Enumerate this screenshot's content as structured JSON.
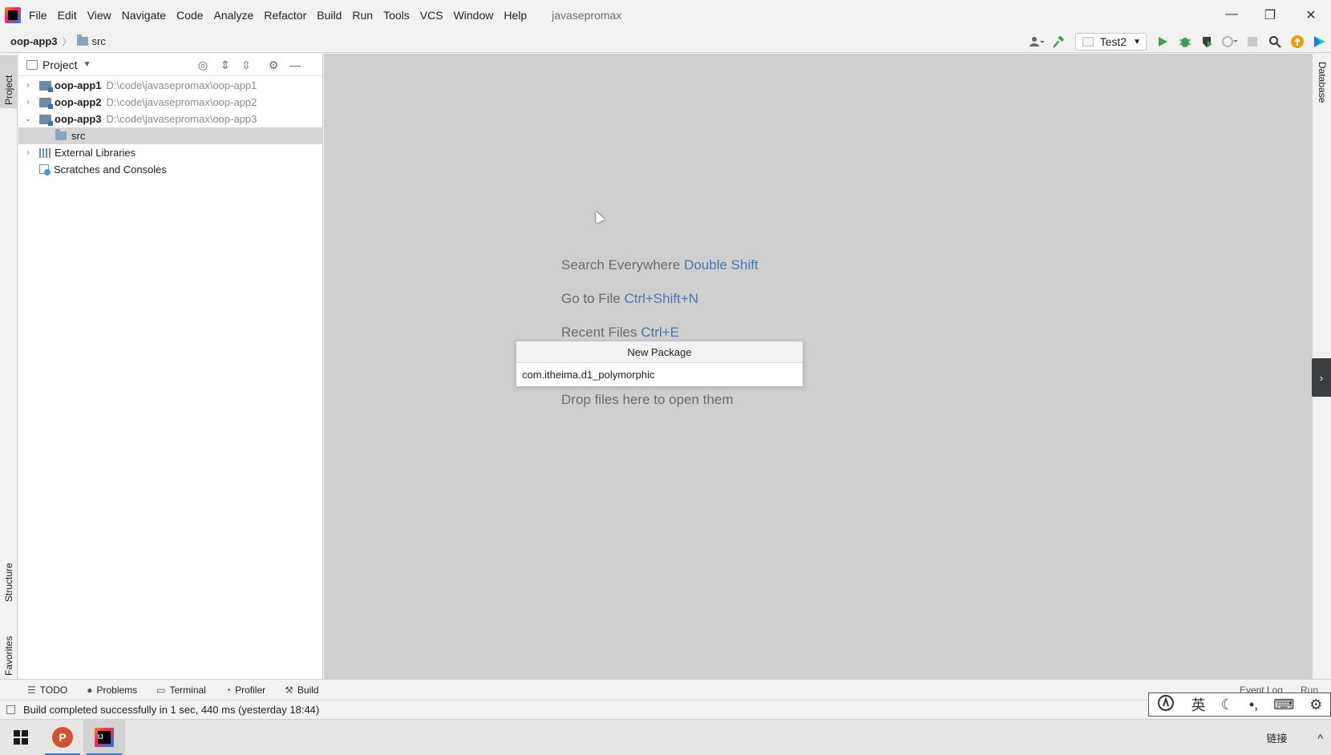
{
  "titlebar": {
    "menu": [
      "File",
      "Edit",
      "View",
      "Navigate",
      "Code",
      "Analyze",
      "Refactor",
      "Build",
      "Run",
      "Tools",
      "VCS",
      "Window",
      "Help"
    ],
    "project_name": "javasepromax",
    "minimize": "—",
    "restore": "❐",
    "close": "✕"
  },
  "navbar": {
    "root": "oop-app3",
    "separator": "〉",
    "folder": "src",
    "run_config": "Test2"
  },
  "left_strip": {
    "project": "Project",
    "structure": "Structure",
    "favorites": "Favorites"
  },
  "project_panel": {
    "title": "Project",
    "tree": [
      {
        "arrow": "›",
        "name": "oop-app1",
        "path": "D:\\code\\javasepromax\\oop-app1"
      },
      {
        "arrow": "›",
        "name": "oop-app2",
        "path": "D:\\code\\javasepromax\\oop-app2"
      },
      {
        "arrow": "⌄",
        "name": "oop-app3",
        "path": "D:\\code\\javasepromax\\oop-app3"
      },
      {
        "name": "src"
      },
      {
        "arrow": "›",
        "name": "External Libraries"
      },
      {
        "name": "Scratches and Consoles"
      }
    ]
  },
  "editor": {
    "hints": [
      {
        "label": "Search Everywhere",
        "key": "Double Shift"
      },
      {
        "label": "Go to File",
        "key": "Ctrl+Shift+N"
      },
      {
        "label": "Recent Files",
        "key": "Ctrl+E"
      },
      {
        "label": "Drop files here to open them",
        "key": ""
      }
    ]
  },
  "new_package": {
    "title": "New Package",
    "value": "com.itheima.d1_polymorphic"
  },
  "right_strip": {
    "database": "Database",
    "collapse": "›"
  },
  "bottom_tabs": [
    {
      "icon": "☰",
      "label": "TODO"
    },
    {
      "icon": "●",
      "label": "Problems"
    },
    {
      "icon": "▭",
      "label": "Terminal"
    },
    {
      "icon": "◔",
      "label": "Profiler"
    },
    {
      "icon": "⚒",
      "label": "Build"
    }
  ],
  "bottom_right_tabs": [
    "Event Log",
    "Run"
  ],
  "status": {
    "text": "Build completed successfully in 1 sec, 440 ms (yesterday 18:44)"
  },
  "ime": {
    "items": [
      "英",
      "☾",
      "•,",
      "⌨",
      "⚙"
    ]
  },
  "taskbar": {
    "ppt_letter": "P",
    "tray_link": "链接",
    "chevron": "^"
  },
  "colors": {
    "editor_bg": "#cfcfcf",
    "hint_key": "#3f77b6",
    "run_green": "#3da24a",
    "selection": "#d5d5d5"
  }
}
